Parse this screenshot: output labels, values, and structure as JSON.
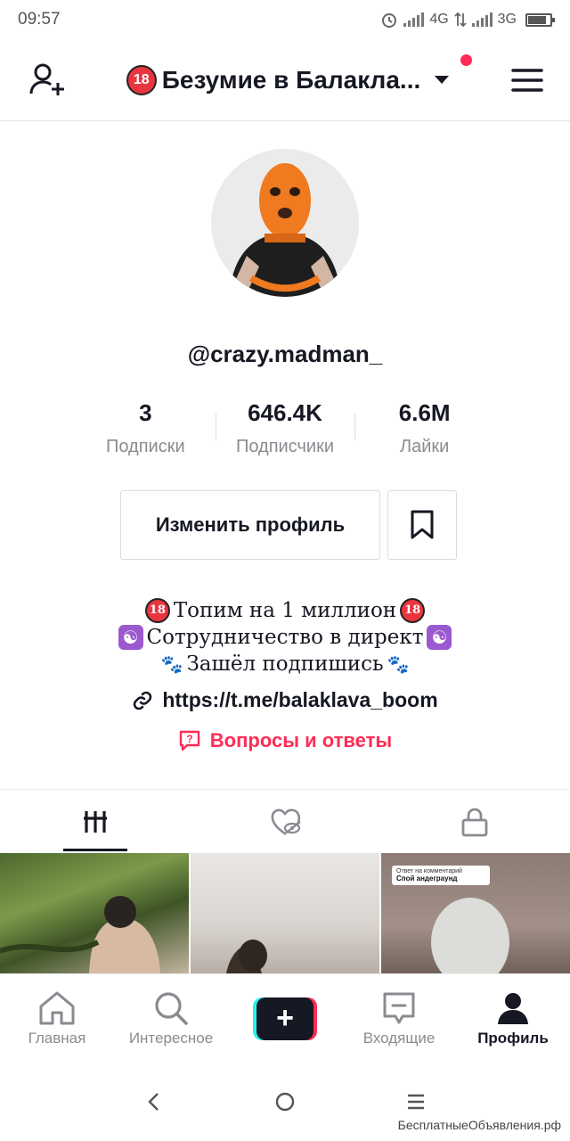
{
  "status_bar": {
    "time": "09:57",
    "network1": "4G",
    "network2": "3G"
  },
  "header": {
    "title": "Безумие в Балакла...",
    "title_badge": "18",
    "has_notification": true
  },
  "profile": {
    "username": "@crazy.madman_",
    "stats": [
      {
        "value": "3",
        "label": "Подписки"
      },
      {
        "value": "646.4K",
        "label": "Подписчики"
      },
      {
        "value": "6.6M",
        "label": "Лайки"
      }
    ],
    "edit_button": "Изменить профиль",
    "bio_lines": [
      "Топим на 1 миллион",
      "Сотрудничество в директ",
      "Зашёл подпишись"
    ],
    "link": "https://t.me/balaklava_boom",
    "qa_label": "Вопросы и ответы"
  },
  "tabs": [
    {
      "name": "videos",
      "active": true
    },
    {
      "name": "liked",
      "active": false
    },
    {
      "name": "private",
      "active": false
    }
  ],
  "thumbnails": [
    {
      "caption": ""
    },
    {
      "caption": ""
    },
    {
      "caption_small": "Ответ на комментарий",
      "caption": "Спой андеграунд"
    }
  ],
  "bottom_nav": [
    {
      "label": "Главная",
      "icon": "home-icon"
    },
    {
      "label": "Интересное",
      "icon": "search-icon"
    },
    {
      "label": "",
      "icon": "plus-icon"
    },
    {
      "label": "Входящие",
      "icon": "inbox-icon"
    },
    {
      "label": "Профиль",
      "icon": "profile-icon",
      "active": true
    }
  ],
  "watermark": "БесплатныеОбъявления.рф",
  "colors": {
    "accent": "#fe2c55",
    "cyan": "#25f4ee",
    "text": "#161823",
    "muted": "#8a8b91"
  }
}
